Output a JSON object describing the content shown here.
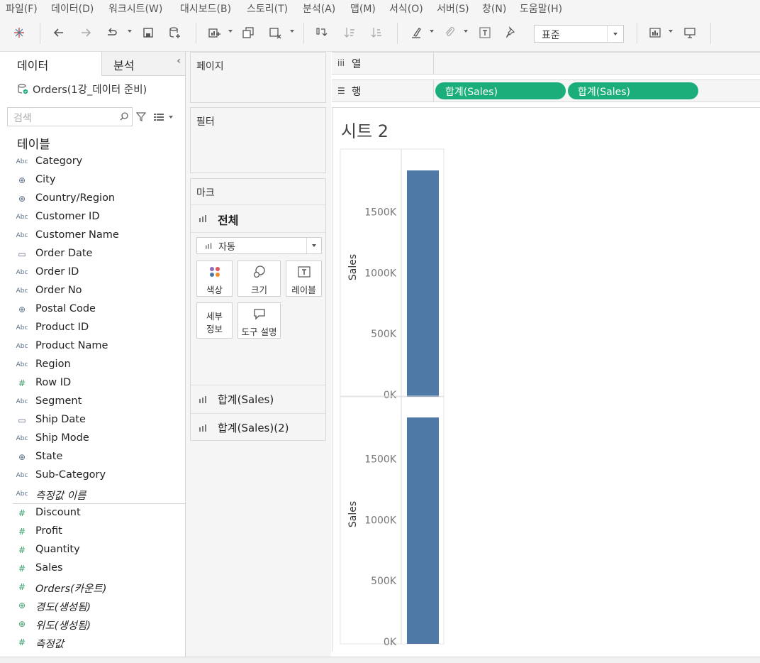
{
  "menu": [
    "파일(F)",
    "데이터(D)",
    "워크시트(W)",
    "대시보드(B)",
    "스토리(T)",
    "분석(A)",
    "맵(M)",
    "서식(O)",
    "서버(S)",
    "창(N)",
    "도움말(H)"
  ],
  "toolbar": {
    "icons": [
      "tableau-logo-icon",
      "undo-icon",
      "redo-icon",
      "replay-icon",
      "save-icon",
      "new-datasource-icon",
      "new-worksheet-icon",
      "duplicate-sheet-icon",
      "clear-sheet-icon",
      "swap-icon",
      "sort-ascending-icon",
      "sort-descending-icon",
      "highlight-icon",
      "group-icon",
      "label-icon",
      "pin-icon",
      "show-me-icon",
      "presentation-icon"
    ],
    "fit_value": "표준"
  },
  "data_pane": {
    "tab_data": "데이터",
    "tab_analysis": "분석",
    "collapse_glyph": "‹",
    "datasource": "Orders(1강_데이터 준비)",
    "search_placeholder": "검색",
    "tables_heading": "테이블",
    "dimensions": [
      {
        "icon": "Abc",
        "name": "Category"
      },
      {
        "icon": "globe",
        "name": "City"
      },
      {
        "icon": "globe",
        "name": "Country/Region"
      },
      {
        "icon": "Abc",
        "name": "Customer ID"
      },
      {
        "icon": "Abc",
        "name": "Customer Name"
      },
      {
        "icon": "cal",
        "name": "Order Date"
      },
      {
        "icon": "Abc",
        "name": "Order ID"
      },
      {
        "icon": "Abc",
        "name": "Order No"
      },
      {
        "icon": "globe",
        "name": "Postal Code"
      },
      {
        "icon": "Abc",
        "name": "Product ID"
      },
      {
        "icon": "Abc",
        "name": "Product Name"
      },
      {
        "icon": "Abc",
        "name": "Region"
      },
      {
        "icon": "#",
        "name": "Row ID"
      },
      {
        "icon": "Abc",
        "name": "Segment"
      },
      {
        "icon": "cal",
        "name": "Ship Date"
      },
      {
        "icon": "Abc",
        "name": "Ship Mode"
      },
      {
        "icon": "globe",
        "name": "State"
      },
      {
        "icon": "Abc",
        "name": "Sub-Category"
      },
      {
        "icon": "Abc",
        "name": "측정값 이름",
        "italic": true
      }
    ],
    "measures": [
      {
        "icon": "#",
        "name": "Discount"
      },
      {
        "icon": "#",
        "name": "Profit"
      },
      {
        "icon": "#",
        "name": "Quantity"
      },
      {
        "icon": "#",
        "name": "Sales"
      },
      {
        "icon": "#",
        "name": "Orders(카운트)",
        "italic": true
      },
      {
        "icon": "globe",
        "name": "경도(생성됨)",
        "italic": true
      },
      {
        "icon": "globe",
        "name": "위도(생성됨)",
        "italic": true
      },
      {
        "icon": "#",
        "name": "측정값",
        "italic": true
      }
    ]
  },
  "cards": {
    "pages": "페이지",
    "filters": "필터",
    "marks": "마크",
    "marks_all": "전체",
    "mark_type": "자동",
    "color": "색상",
    "size": "크기",
    "label": "레이블",
    "detail_line1": "세부",
    "detail_line2": "정보",
    "tooltip": "도구 설명",
    "mark_rows": [
      "합계(Sales)",
      "합계(Sales)(2)"
    ]
  },
  "shelves": {
    "columns_label": "열",
    "rows_label": "행",
    "row_pills": [
      "합계(Sales)",
      "합계(Sales)"
    ]
  },
  "sheet_title": "시트 2",
  "chart_data": [
    {
      "type": "bar",
      "categories": [
        ""
      ],
      "values": [
        1840000
      ],
      "ylabel": "Sales",
      "yticks": [
        "0K",
        "500K",
        "1000K",
        "1500K"
      ],
      "ylim": [
        0,
        1800000
      ],
      "color": "#4e79a7"
    },
    {
      "type": "bar",
      "categories": [
        ""
      ],
      "values": [
        1840000
      ],
      "ylabel": "Sales",
      "yticks": [
        "0K",
        "500K",
        "1000K",
        "1500K"
      ],
      "ylim": [
        0,
        1800000
      ],
      "color": "#4e79a7"
    }
  ]
}
